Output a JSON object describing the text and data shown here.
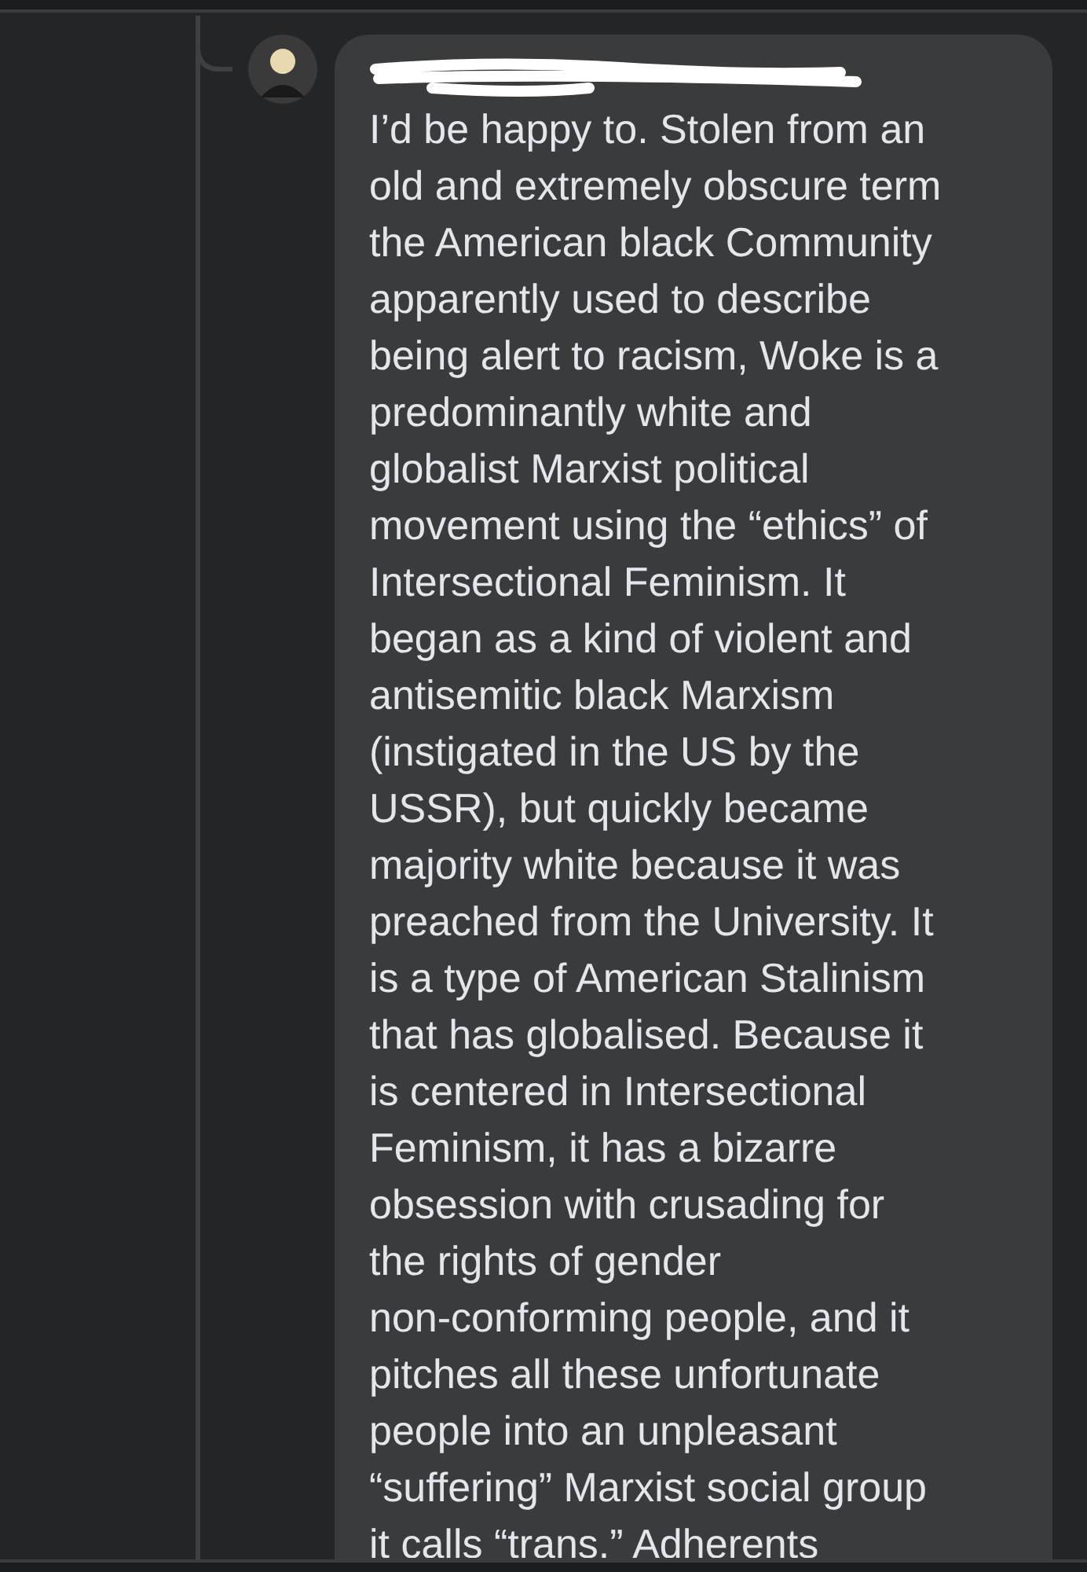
{
  "comment": {
    "lines": [
      "I’d be happy to. Stolen from an",
      "old and extremely obscure term",
      "the American black Community",
      "apparently used to describe",
      "being alert to racism, Woke is a",
      "predominantly white and",
      "globalist Marxist political",
      "movement using the “ethics” of",
      "Intersectional Feminism. It",
      "began as a kind of violent and",
      "antisemitic black Marxism",
      "(instigated in the US by the",
      "USSR), but quickly became",
      "majority white because it was",
      "preached from the University. It",
      "is a type of American Stalinism",
      "that has globalised. Because it",
      "is centered in Intersectional",
      "Feminism, it has a bizarre",
      "obsession with crusading for",
      "the rights of gender",
      "non-conforming people, and it",
      "pitches all these unfortunate",
      "people into an unpleasant",
      "“suffering” Marxist social group",
      "it calls “trans.” Adherents"
    ]
  }
}
